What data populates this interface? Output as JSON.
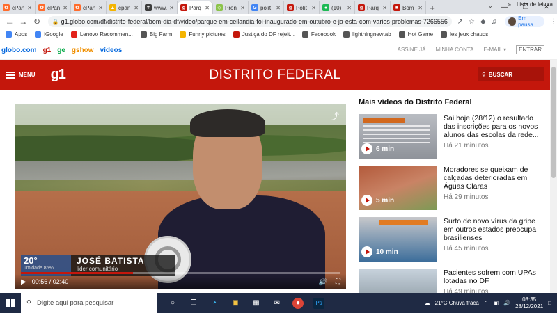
{
  "browser": {
    "tabs": [
      {
        "title": "cPan",
        "color": "#ff6c2c",
        "glyph": "✿"
      },
      {
        "title": "cPan",
        "color": "#ff6c2c",
        "glyph": "✿"
      },
      {
        "title": "cPan",
        "color": "#ff6c2c",
        "glyph": "✿"
      },
      {
        "title": "cpan",
        "color": "#f4b400",
        "glyph": "▲"
      },
      {
        "title": "www.",
        "color": "#3c3c3c",
        "glyph": "✝"
      },
      {
        "title": "Parq",
        "color": "#c4170c",
        "glyph": "g"
      },
      {
        "title": "Pron",
        "color": "#8bc34a",
        "glyph": "◇"
      },
      {
        "title": "polít",
        "color": "#4285f4",
        "glyph": "G"
      },
      {
        "title": "Polít",
        "color": "#c4170c",
        "glyph": "g"
      },
      {
        "title": "(10)",
        "color": "#1db954",
        "glyph": "●"
      },
      {
        "title": "Parq",
        "color": "#c4170c",
        "glyph": "g"
      },
      {
        "title": "Bom",
        "color": "#c4170c",
        "glyph": "■"
      }
    ],
    "new_tab": "+",
    "url": "g1.globo.com/df/distrito-federal/bom-dia-df/video/parque-em-ceilandia-foi-inaugurado-em-outubro-e-ja-esta-com-varios-problemas-7266556.ghtml",
    "profile_label": "Em pausa",
    "bookmarks": [
      {
        "label": "Apps",
        "color": "#4285f4"
      },
      {
        "label": "iGoogle",
        "color": "#4285f4"
      },
      {
        "label": "Lenovo Recommen...",
        "color": "#e2231a"
      },
      {
        "label": "Big Farm",
        "color": "#555555"
      },
      {
        "label": "Funny pictures",
        "color": "#f4b400"
      },
      {
        "label": "Justiça do DF rejeit...",
        "color": "#c4170c"
      },
      {
        "label": "Facebook",
        "color": "#555555"
      },
      {
        "label": "lightningnewtab",
        "color": "#555555"
      },
      {
        "label": "Hot Game",
        "color": "#555555"
      },
      {
        "label": "les jeux chauds",
        "color": "#555555"
      }
    ],
    "reading_list": "Lista de leitura"
  },
  "globobar": {
    "links": [
      "globo.com",
      "g1",
      "ge",
      "gshow",
      "vídeos"
    ],
    "right": [
      "ASSINE JÁ",
      "MINHA CONTA",
      "E-MAIL ▾"
    ],
    "entrar": "ENTRAR"
  },
  "header": {
    "menu_label": "MENU",
    "logo": "g1",
    "section": "DISTRITO FEDERAL",
    "search_label": "BUSCAR"
  },
  "player": {
    "weather_temp": "20°",
    "weather_humidity": "umidade 85%",
    "name": "JOSÉ BATISTA",
    "role": "líder comunitário",
    "time": "00:56 / 02:40",
    "progress_fraction": 0.35
  },
  "sidebar": {
    "title": "Mais vídeos do Distrito Federal",
    "items": [
      {
        "title": "Sai hoje (28/12) o resultado das inscrições para os novos alunos das escolas da rede...",
        "ago": "Há 21 minutos",
        "duration": "6 min"
      },
      {
        "title": "Moradores se queixam de calçadas deterioradas em Águas Claras",
        "ago": "Há 29 minutos",
        "duration": "5 min"
      },
      {
        "title": "Surto de novo vírus da gripe em outros estados preocupa brasilienses",
        "ago": "Há 45 minutos",
        "duration": "10 min"
      },
      {
        "title": "Pacientes sofrem com UPAs lotadas no DF",
        "ago": "Há 49 minutos",
        "duration": ""
      }
    ]
  },
  "taskbar": {
    "search_placeholder": "Digite aqui para pesquisar",
    "weather": "21°C  Chuva fraca",
    "time": "08:35",
    "date": "28/12/2021"
  }
}
